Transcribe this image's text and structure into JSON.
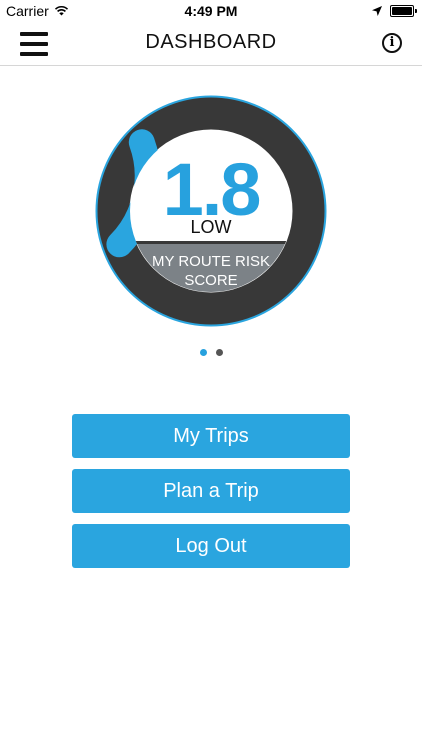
{
  "status_bar": {
    "carrier": "Carrier",
    "time": "4:49 PM",
    "icons": [
      "wifi-icon",
      "location-arrow-icon",
      "battery-icon"
    ]
  },
  "nav": {
    "title": "DASHBOARD",
    "menu_icon": "hamburger-menu-icon",
    "info_icon": "info-icon",
    "info_glyph": "i"
  },
  "risk_score": {
    "value": "1.8",
    "level": "LOW",
    "caption": "MY ROUTE RISK SCORE",
    "score_fraction": 0.18
  },
  "pager": {
    "count": 2,
    "active_index": 0
  },
  "actions": [
    {
      "label": "My Trips"
    },
    {
      "label": "Plan a Trip"
    },
    {
      "label": "Log Out"
    }
  ],
  "colors": {
    "accent": "#2aa5df",
    "ring_dark": "#383838",
    "caption_band": "#7c8287",
    "background": "#ffffff"
  }
}
